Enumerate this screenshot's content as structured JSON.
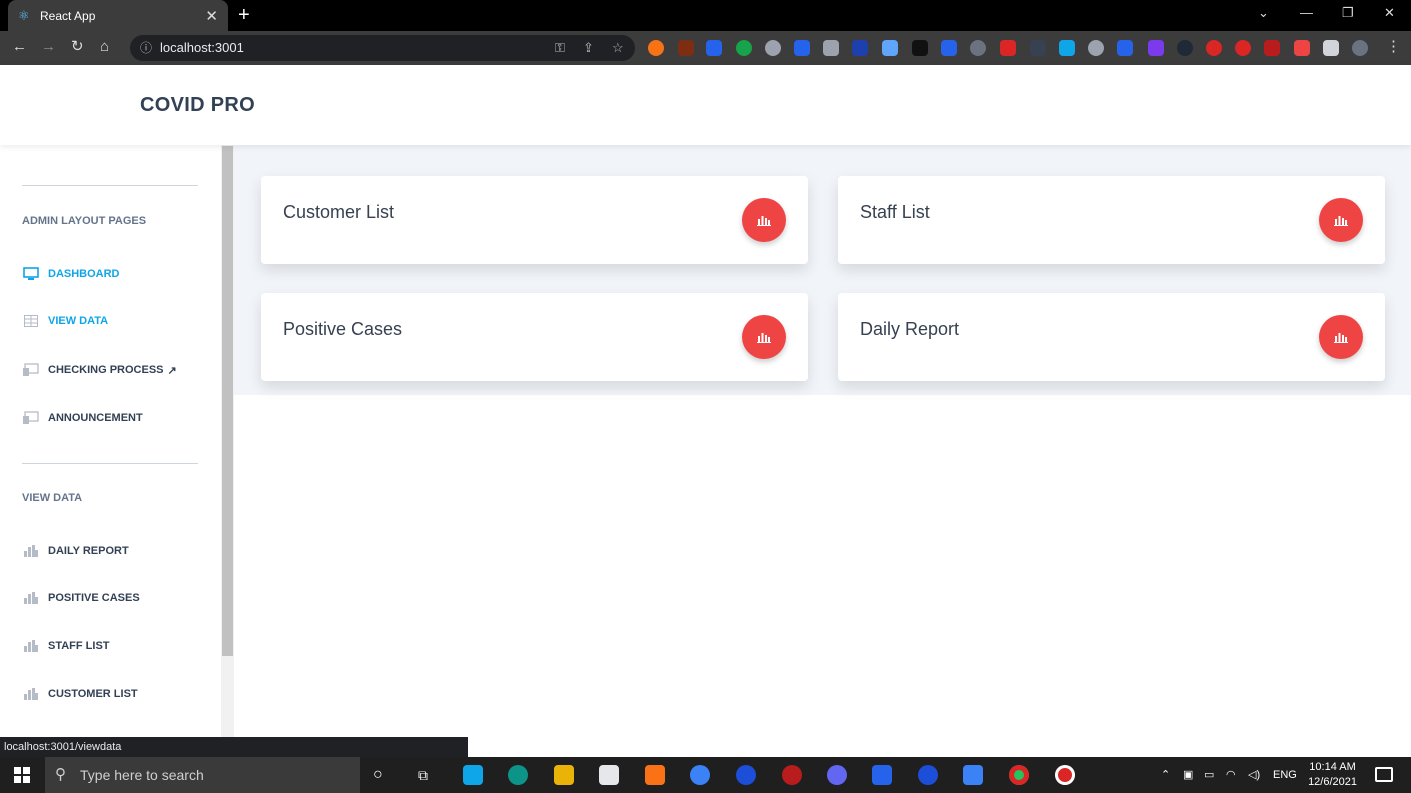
{
  "browser": {
    "tab_title": "React App",
    "tab_close": "✕",
    "new_tab": "+",
    "url": "localhost:3001",
    "status_link": "localhost:3001/viewdata"
  },
  "app": {
    "brand": "COVID PRO"
  },
  "sidebar": {
    "section1_title": "ADMIN LAYOUT PAGES",
    "admin_items": [
      {
        "label": "DASHBOARD",
        "icon": "monitor-icon",
        "active": true
      },
      {
        "label": "VIEW DATA",
        "icon": "table-icon",
        "active": true
      },
      {
        "label": "CHECKING PROCESS",
        "icon": "screen-icon",
        "active": false
      },
      {
        "label": "ANNOUNCEMENT",
        "icon": "screen-icon",
        "active": false
      }
    ],
    "section2_title": "VIEW DATA",
    "data_items": [
      {
        "label": "DAILY REPORT",
        "icon": "chart-icon"
      },
      {
        "label": "POSITIVE CASES",
        "icon": "chart-icon"
      },
      {
        "label": "STAFF LIST",
        "icon": "chart-icon"
      },
      {
        "label": "CUSTOMER LIST",
        "icon": "chart-icon"
      }
    ]
  },
  "cards": [
    {
      "title": "Customer List",
      "icon": "bar-chart-icon"
    },
    {
      "title": "Staff List",
      "icon": "bar-chart-icon"
    },
    {
      "title": "Positive Cases",
      "icon": "bar-chart-icon"
    },
    {
      "title": "Daily Report",
      "icon": "bar-chart-icon"
    }
  ],
  "taskbar": {
    "search_placeholder": "Type here to search",
    "language": "ENG",
    "time": "10:14 AM",
    "date": "12/6/2021"
  },
  "colors": {
    "accent": "#0ea5e9",
    "card_button": "#ef4444"
  }
}
